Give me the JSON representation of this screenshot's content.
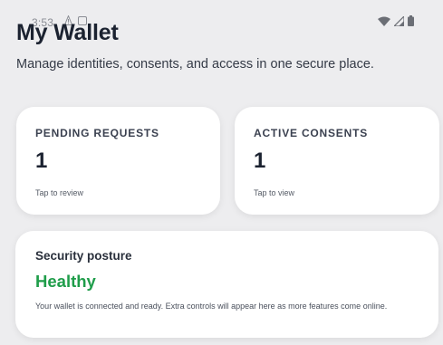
{
  "status_bar": {
    "time": "3:53",
    "left_icons": [
      "alert-icon",
      "notification-square-icon"
    ],
    "right_icons": [
      "wifi-icon",
      "cellular-signal-icon",
      "battery-icon"
    ]
  },
  "header": {
    "title": "My Wallet",
    "subtitle": "Manage identities, consents, and access in one secure place."
  },
  "cards": {
    "pending": {
      "label": "PENDING REQUESTS",
      "value": "1",
      "hint": "Tap to review"
    },
    "consents": {
      "label": "ACTIVE CONSENTS",
      "value": "1",
      "hint": "Tap to view"
    }
  },
  "security": {
    "title": "Security posture",
    "status": "Healthy",
    "description": "Your wallet is connected and ready. Extra controls will appear here as more features come online."
  },
  "colors": {
    "background": "#ededef",
    "card": "#ffffff",
    "healthy": "#1f9d4a",
    "text_primary": "#1b2230",
    "status_icons": "#8a8d94"
  }
}
